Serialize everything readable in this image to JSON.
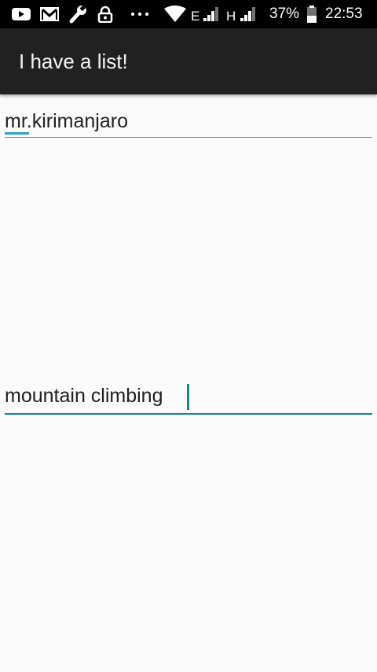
{
  "status_bar": {
    "battery_percent": "37%",
    "time": "22:53",
    "network_type_1": "E",
    "network_type_2": "H",
    "icons": [
      "youtube-icon",
      "gmail-icon",
      "wrench-icon",
      "lock-icon",
      "more-dots-icon",
      "wifi-icon",
      "signal-icon",
      "signal-icon",
      "battery-icon"
    ]
  },
  "app_bar": {
    "title": "I have a list!"
  },
  "fields": {
    "first": {
      "value": "mr.kirimanjaro"
    },
    "second": {
      "value": "mountain climbing"
    }
  },
  "colors": {
    "accent": "#138a87",
    "spellcheck": "#2f9fc4",
    "app_bar": "#212121",
    "background": "#fafafa"
  }
}
